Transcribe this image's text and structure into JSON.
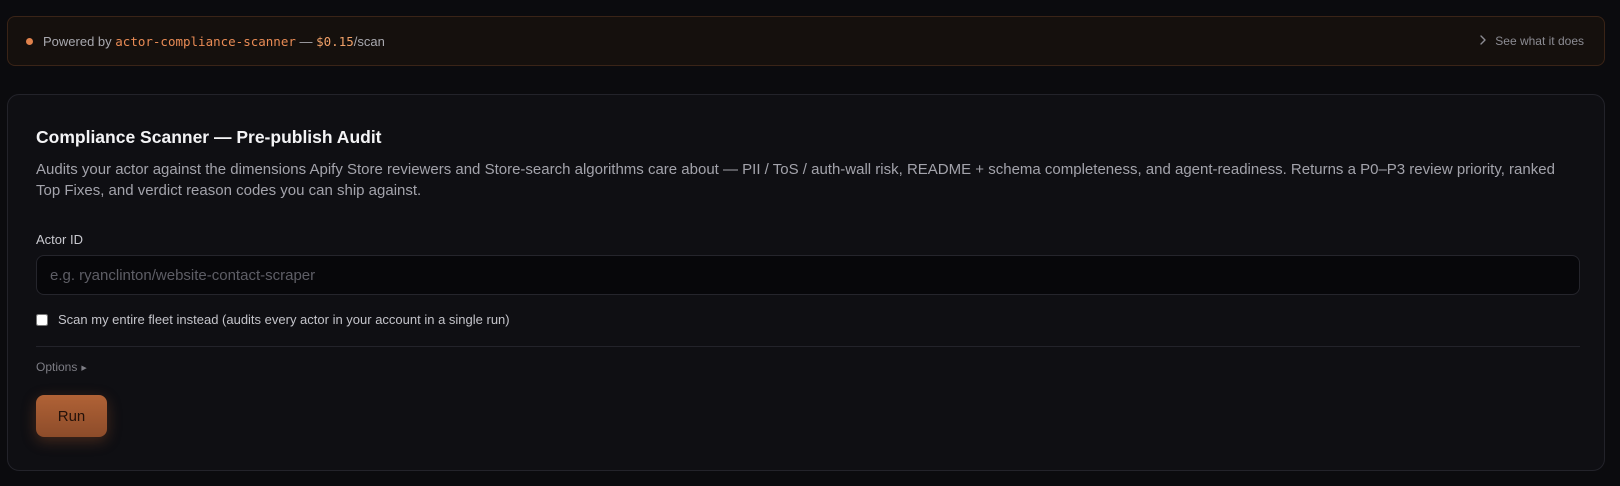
{
  "banner": {
    "prefix": "Powered by ",
    "actor_name": "actor-compliance-scanner",
    "separator": " — ",
    "price": "$0.15",
    "price_unit": "/scan",
    "link_label": "See what it does",
    "link_icon": "chevron-right-icon",
    "status_color": "#e0824c"
  },
  "card": {
    "title": "Compliance Scanner — Pre-publish Audit",
    "description": "Audits your actor against the dimensions Apify Store reviewers and Store-search algorithms care about — PII / ToS / auth-wall risk, README + schema completeness, and agent-readiness. Returns a P0–P3 review priority, ranked Top Fixes, and verdict reason codes you can ship against.",
    "actor_id_label": "Actor ID",
    "actor_id_value": "",
    "actor_id_placeholder": "e.g. ryanclinton/website-contact-scraper",
    "fleet_checkbox_label": "Scan my entire fleet instead (audits every actor in your account in a single run)",
    "fleet_checked": false,
    "options_label": "Options",
    "options_icon": "triangle-right-icon",
    "run_label": "Run"
  },
  "colors": {
    "accent": "#e98b55",
    "run_button": "#a05830",
    "background": "#0b0b0e"
  }
}
